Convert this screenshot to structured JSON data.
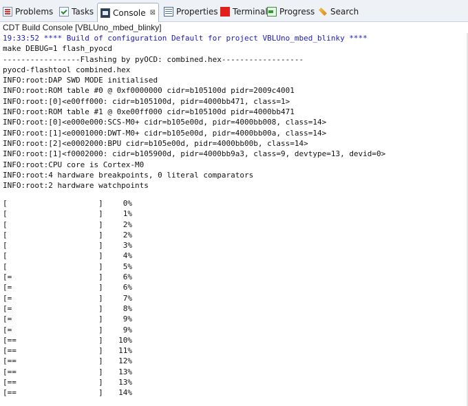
{
  "tabs": [
    {
      "label": "Problems",
      "icon": "problems-icon"
    },
    {
      "label": "Tasks",
      "icon": "tasks-icon"
    },
    {
      "label": "Console",
      "icon": "console-icon",
      "active": true,
      "close": "⊠"
    },
    {
      "label": "Properties",
      "icon": "properties-icon"
    },
    {
      "label": "Terminal",
      "icon": "terminal-icon"
    },
    {
      "label": "Progress",
      "icon": "progress-icon"
    },
    {
      "label": "Search",
      "icon": "search-icon"
    }
  ],
  "console_title": "CDT Build Console [VBLUno_mbed_blinky]",
  "lines": [
    {
      "text": "19:33:52 **** Build of configuration Default for project VBLUno_mbed_blinky ****",
      "style": "cmd"
    },
    {
      "text": "make DEBUG=1 flash_pyocd",
      "style": "normal"
    },
    {
      "text": "-----------------Flashing by pyOCD: combined.hex------------------",
      "style": "normal"
    },
    {
      "text": "pyocd-flashtool combined.hex",
      "style": "normal"
    },
    {
      "text": "INFO:root:DAP SWD MODE initialised",
      "style": "normal"
    },
    {
      "text": "INFO:root:ROM table #0 @ 0xf0000000 cidr=b105100d pidr=2009c4001",
      "style": "normal"
    },
    {
      "text": "INFO:root:[0]<e00ff000: cidr=b105100d, pidr=4000bb471, class=1>",
      "style": "normal"
    },
    {
      "text": "INFO:root:ROM table #1 @ 0xe00ff000 cidr=b105100d pidr=4000bb471",
      "style": "normal"
    },
    {
      "text": "INFO:root:[0]<e000e000:SCS-M0+ cidr=b105e00d, pidr=4000bb008, class=14>",
      "style": "normal"
    },
    {
      "text": "INFO:root:[1]<e0001000:DWT-M0+ cidr=b105e00d, pidr=4000bb00a, class=14>",
      "style": "normal"
    },
    {
      "text": "INFO:root:[2]<e0002000:BPU cidr=b105e00d, pidr=4000bb00b, class=14>",
      "style": "normal"
    },
    {
      "text": "INFO:root:[1]<f0002000: cidr=b105900d, pidr=4000bb9a3, class=9, devtype=13, devid=0>",
      "style": "normal"
    },
    {
      "text": "INFO:root:CPU core is Cortex-M0",
      "style": "normal"
    },
    {
      "text": "INFO:root:4 hardware breakpoints, 0 literal comparators",
      "style": "normal"
    },
    {
      "text": "INFO:root:2 hardware watchpoints",
      "style": "normal"
    }
  ],
  "progress_rows": [
    {
      "bar": "[                    ]",
      "pct": "0%"
    },
    {
      "bar": "[                    ]",
      "pct": "1%"
    },
    {
      "bar": "[                    ]",
      "pct": "2%"
    },
    {
      "bar": "[                    ]",
      "pct": "2%"
    },
    {
      "bar": "[                    ]",
      "pct": "3%"
    },
    {
      "bar": "[                    ]",
      "pct": "4%"
    },
    {
      "bar": "[                    ]",
      "pct": "5%"
    },
    {
      "bar": "[=                   ]",
      "pct": "6%"
    },
    {
      "bar": "[=                   ]",
      "pct": "6%"
    },
    {
      "bar": "[=                   ]",
      "pct": "7%"
    },
    {
      "bar": "[=                   ]",
      "pct": "8%"
    },
    {
      "bar": "[=                   ]",
      "pct": "9%"
    },
    {
      "bar": "[=                   ]",
      "pct": "9%"
    },
    {
      "bar": "[==                  ]",
      "pct": "10%"
    },
    {
      "bar": "[==                  ]",
      "pct": "11%"
    },
    {
      "bar": "[==                  ]",
      "pct": "12%"
    },
    {
      "bar": "[==                  ]",
      "pct": "13%"
    },
    {
      "bar": "[==                  ]",
      "pct": "13%"
    },
    {
      "bar": "[==                  ]",
      "pct": "14%"
    }
  ],
  "colors": {
    "command_text": "#1a1acc",
    "terminal_icon": "#e0201a"
  }
}
